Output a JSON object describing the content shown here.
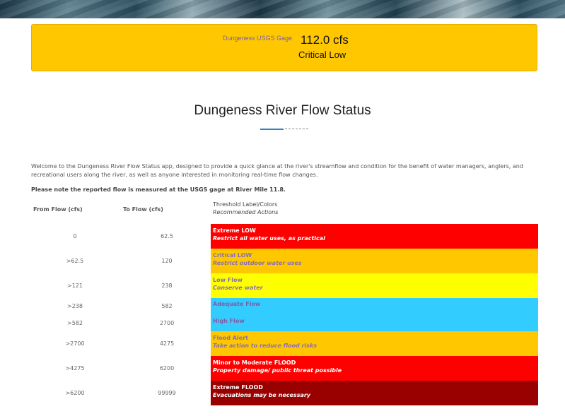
{
  "gage": {
    "name": "Dungeness USGS Gage",
    "flow": "112.0 cfs",
    "status": "Critical Low",
    "color": "#ffc700"
  },
  "page": {
    "title": "Dungeness River Flow Status",
    "intro": "Welcome to the Dungeness River Flow Status app, designed to provide a quick glance at the river's streamflow and condition for the benefit of water managers, anglers, and recreational users along the river, as well as anyone interested in monitoring real-time flow changes.",
    "note": "Please note the reported flow is measured at the USGS gage at River Mile 11.8."
  },
  "table": {
    "headers": {
      "from": "From Flow (cfs)",
      "to": "To Flow (cfs)",
      "label": "Threshold Label/Colors",
      "actions": "Recommended Actions"
    },
    "rows": [
      {
        "from": "0",
        "to": "62.5",
        "label": "Extreme LOW",
        "action": "Restrict all water uses, as practical",
        "color": "#ff0000",
        "text_color": "#ffffff"
      },
      {
        "from": ">62.5",
        "to": "120",
        "label": "Critical LOW",
        "action": "Restrict outdoor water uses",
        "color": "#ffc700",
        "text_color": "#8a6fb0"
      },
      {
        "from": ">121",
        "to": "238",
        "label": "Low Flow",
        "action": "Conserve water",
        "color": "#ffff00",
        "text_color": "#8a6fb0"
      },
      {
        "from": ">238",
        "to": "582",
        "label": "Adequate Flow",
        "action": "",
        "color": "#33ccff",
        "text_color": "#7b5ea8"
      },
      {
        "from": ">582",
        "to": "2700",
        "label": "High Flow",
        "action": "",
        "color": "#33ccff",
        "text_color": "#7b5ea8"
      },
      {
        "from": ">2700",
        "to": "4275",
        "label": "Flood Alert",
        "action": "Take action to reduce flood risks",
        "color": "#ffc700",
        "text_color": "#8a6fb0"
      },
      {
        "from": ">4275",
        "to": "6200",
        "label": "Minor to Moderate FLOOD",
        "action": "Property damage/ public threat possible",
        "color": "#ff0000",
        "text_color": "#ffffff"
      },
      {
        "from": ">6200",
        "to": "99999",
        "label": "Extreme FLOOD",
        "action": "Evacuations may be necessary",
        "color": "#990000",
        "text_color": "#ffffff"
      }
    ]
  }
}
